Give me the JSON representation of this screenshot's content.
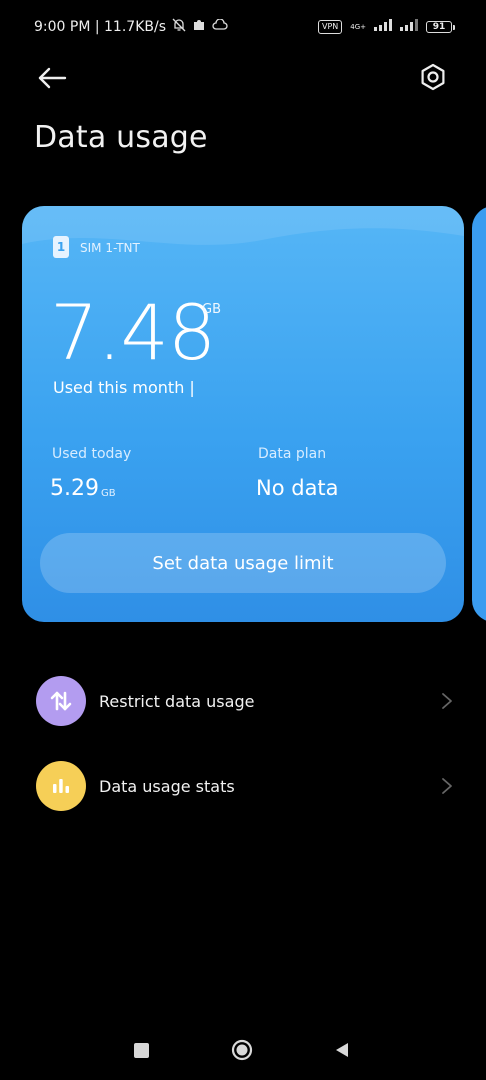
{
  "status_bar": {
    "time_speed": "9:00 PM | 11.7KB/s",
    "vpn": "VPN",
    "net_top": "4G+",
    "battery": "91"
  },
  "header": {
    "title": "Data usage"
  },
  "card": {
    "sim_number": "1",
    "sim_label": "SIM 1-TNT",
    "month_value": "7.48",
    "month_unit": "GB",
    "month_label": "Used this month |",
    "today_label": "Used today",
    "today_value": "5.29",
    "today_unit": "GB",
    "plan_label": "Data plan",
    "plan_value": "No data",
    "limit_button": "Set data usage limit"
  },
  "list": {
    "items": [
      {
        "label": "Restrict data usage",
        "icon": "swap-arrows-icon",
        "color": "#b39cf0"
      },
      {
        "label": "Data usage stats",
        "icon": "bar-chart-icon",
        "color": "#f6cf57"
      }
    ]
  },
  "colors": {
    "card_gradient_top": "#56b6f6",
    "card_gradient_bottom": "#2f8fe6",
    "background": "#000000"
  }
}
